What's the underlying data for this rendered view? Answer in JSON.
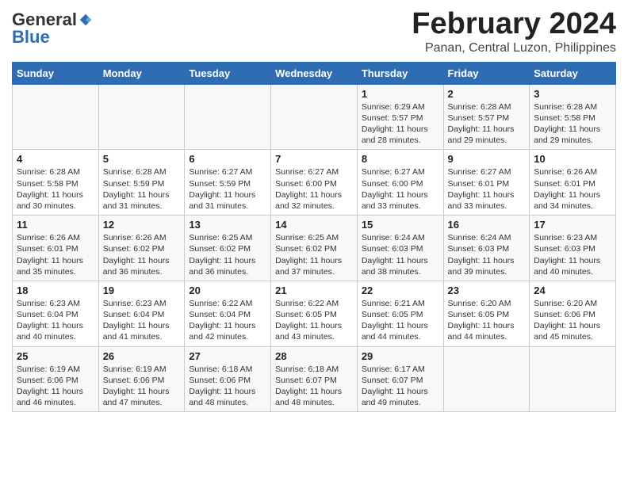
{
  "header": {
    "logo_general": "General",
    "logo_blue": "Blue",
    "title": "February 2024",
    "subtitle": "Panan, Central Luzon, Philippines"
  },
  "weekdays": [
    "Sunday",
    "Monday",
    "Tuesday",
    "Wednesday",
    "Thursday",
    "Friday",
    "Saturday"
  ],
  "weeks": [
    [
      {
        "day": "",
        "info": ""
      },
      {
        "day": "",
        "info": ""
      },
      {
        "day": "",
        "info": ""
      },
      {
        "day": "",
        "info": ""
      },
      {
        "day": "1",
        "info": "Sunrise: 6:29 AM\nSunset: 5:57 PM\nDaylight: 11 hours\nand 28 minutes."
      },
      {
        "day": "2",
        "info": "Sunrise: 6:28 AM\nSunset: 5:57 PM\nDaylight: 11 hours\nand 29 minutes."
      },
      {
        "day": "3",
        "info": "Sunrise: 6:28 AM\nSunset: 5:58 PM\nDaylight: 11 hours\nand 29 minutes."
      }
    ],
    [
      {
        "day": "4",
        "info": "Sunrise: 6:28 AM\nSunset: 5:58 PM\nDaylight: 11 hours\nand 30 minutes."
      },
      {
        "day": "5",
        "info": "Sunrise: 6:28 AM\nSunset: 5:59 PM\nDaylight: 11 hours\nand 31 minutes."
      },
      {
        "day": "6",
        "info": "Sunrise: 6:27 AM\nSunset: 5:59 PM\nDaylight: 11 hours\nand 31 minutes."
      },
      {
        "day": "7",
        "info": "Sunrise: 6:27 AM\nSunset: 6:00 PM\nDaylight: 11 hours\nand 32 minutes."
      },
      {
        "day": "8",
        "info": "Sunrise: 6:27 AM\nSunset: 6:00 PM\nDaylight: 11 hours\nand 33 minutes."
      },
      {
        "day": "9",
        "info": "Sunrise: 6:27 AM\nSunset: 6:01 PM\nDaylight: 11 hours\nand 33 minutes."
      },
      {
        "day": "10",
        "info": "Sunrise: 6:26 AM\nSunset: 6:01 PM\nDaylight: 11 hours\nand 34 minutes."
      }
    ],
    [
      {
        "day": "11",
        "info": "Sunrise: 6:26 AM\nSunset: 6:01 PM\nDaylight: 11 hours\nand 35 minutes."
      },
      {
        "day": "12",
        "info": "Sunrise: 6:26 AM\nSunset: 6:02 PM\nDaylight: 11 hours\nand 36 minutes."
      },
      {
        "day": "13",
        "info": "Sunrise: 6:25 AM\nSunset: 6:02 PM\nDaylight: 11 hours\nand 36 minutes."
      },
      {
        "day": "14",
        "info": "Sunrise: 6:25 AM\nSunset: 6:02 PM\nDaylight: 11 hours\nand 37 minutes."
      },
      {
        "day": "15",
        "info": "Sunrise: 6:24 AM\nSunset: 6:03 PM\nDaylight: 11 hours\nand 38 minutes."
      },
      {
        "day": "16",
        "info": "Sunrise: 6:24 AM\nSunset: 6:03 PM\nDaylight: 11 hours\nand 39 minutes."
      },
      {
        "day": "17",
        "info": "Sunrise: 6:23 AM\nSunset: 6:03 PM\nDaylight: 11 hours\nand 40 minutes."
      }
    ],
    [
      {
        "day": "18",
        "info": "Sunrise: 6:23 AM\nSunset: 6:04 PM\nDaylight: 11 hours\nand 40 minutes."
      },
      {
        "day": "19",
        "info": "Sunrise: 6:23 AM\nSunset: 6:04 PM\nDaylight: 11 hours\nand 41 minutes."
      },
      {
        "day": "20",
        "info": "Sunrise: 6:22 AM\nSunset: 6:04 PM\nDaylight: 11 hours\nand 42 minutes."
      },
      {
        "day": "21",
        "info": "Sunrise: 6:22 AM\nSunset: 6:05 PM\nDaylight: 11 hours\nand 43 minutes."
      },
      {
        "day": "22",
        "info": "Sunrise: 6:21 AM\nSunset: 6:05 PM\nDaylight: 11 hours\nand 44 minutes."
      },
      {
        "day": "23",
        "info": "Sunrise: 6:20 AM\nSunset: 6:05 PM\nDaylight: 11 hours\nand 44 minutes."
      },
      {
        "day": "24",
        "info": "Sunrise: 6:20 AM\nSunset: 6:06 PM\nDaylight: 11 hours\nand 45 minutes."
      }
    ],
    [
      {
        "day": "25",
        "info": "Sunrise: 6:19 AM\nSunset: 6:06 PM\nDaylight: 11 hours\nand 46 minutes."
      },
      {
        "day": "26",
        "info": "Sunrise: 6:19 AM\nSunset: 6:06 PM\nDaylight: 11 hours\nand 47 minutes."
      },
      {
        "day": "27",
        "info": "Sunrise: 6:18 AM\nSunset: 6:06 PM\nDaylight: 11 hours\nand 48 minutes."
      },
      {
        "day": "28",
        "info": "Sunrise: 6:18 AM\nSunset: 6:07 PM\nDaylight: 11 hours\nand 48 minutes."
      },
      {
        "day": "29",
        "info": "Sunrise: 6:17 AM\nSunset: 6:07 PM\nDaylight: 11 hours\nand 49 minutes."
      },
      {
        "day": "",
        "info": ""
      },
      {
        "day": "",
        "info": ""
      }
    ]
  ]
}
